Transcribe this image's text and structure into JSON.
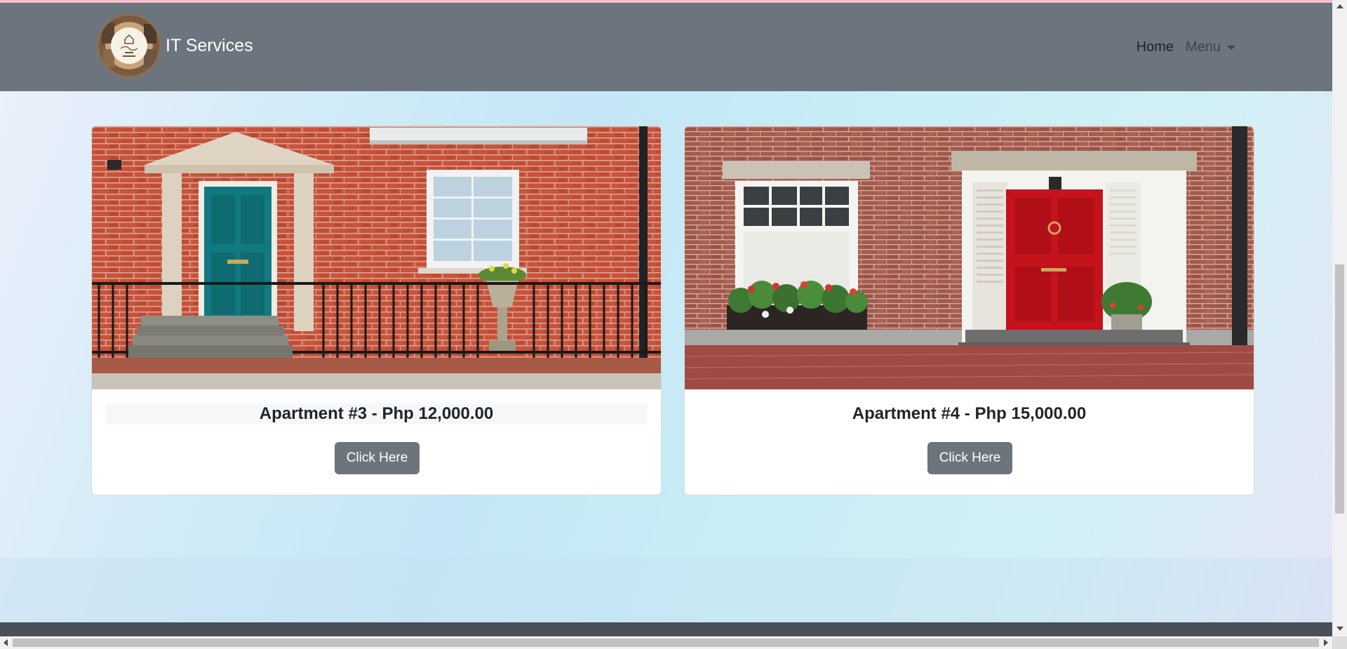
{
  "brand": {
    "title": "IT Services"
  },
  "nav": {
    "home": "Home",
    "menu": "Menu"
  },
  "cards": [
    {
      "title": "Apartment #3 - Php 12,000.00",
      "button": "Click Here"
    },
    {
      "title": "Apartment #4 - Php 15,000.00",
      "button": "Click Here"
    }
  ],
  "colors": {
    "navbar": "#6c757d",
    "button": "#6c757d",
    "footer": "#495057"
  }
}
